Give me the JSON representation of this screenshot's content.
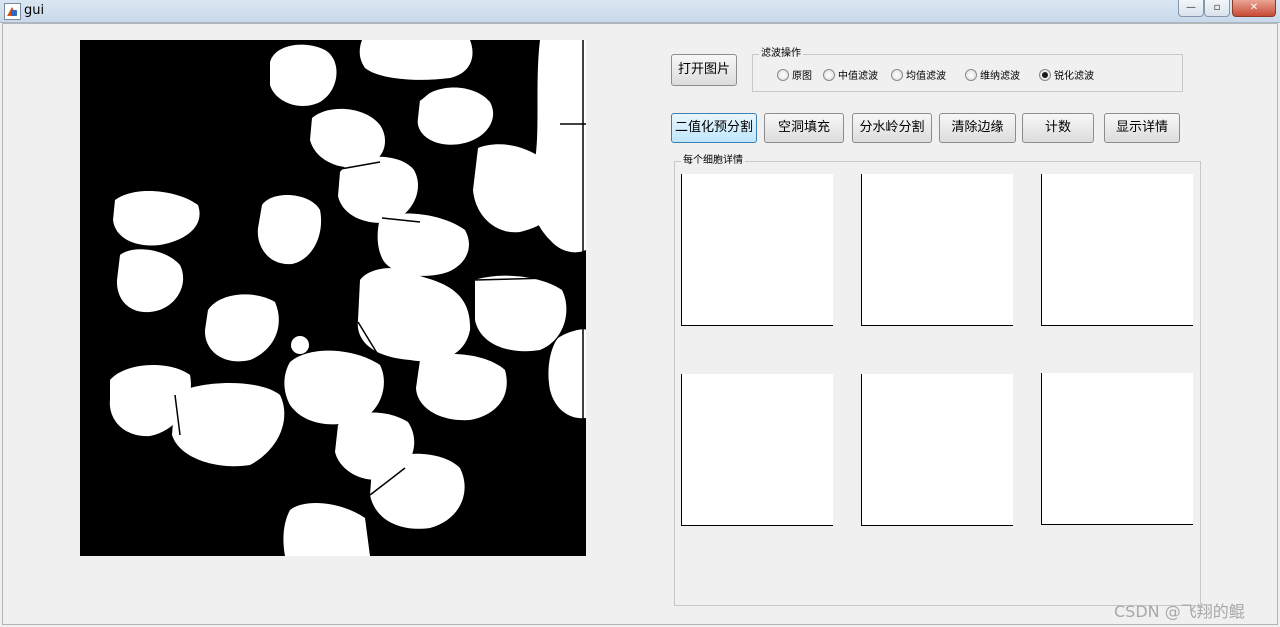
{
  "window": {
    "title": "gui",
    "minimize_glyph": "—",
    "maximize_glyph": "▫",
    "close_glyph": "✕"
  },
  "buttons": {
    "open_image": "打开图片",
    "binarize": "二值化预分割",
    "fill_holes": "空洞填充",
    "watershed": "分水岭分割",
    "clear_border": "清除边缘",
    "count": "计数",
    "show_details": "显示详情"
  },
  "filter_group": {
    "title": "滤波操作",
    "options": [
      "原图",
      "中值滤波",
      "均值滤波",
      "维纳滤波",
      "锐化滤波"
    ],
    "selected": "锐化滤波"
  },
  "details_group": {
    "title": "每个细胞详情"
  },
  "watermark": "CSDN @飞翔的鲲"
}
